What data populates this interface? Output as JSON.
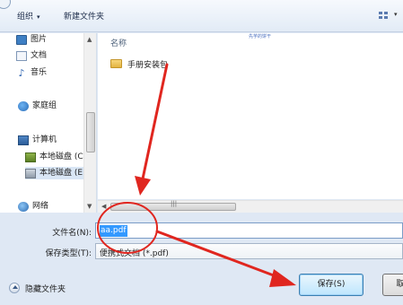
{
  "toolbar": {
    "organize_label": "组织",
    "organize_caret": "▾",
    "new_folder_label": "新建文件夹"
  },
  "nav": {
    "items": [
      {
        "label": "图片",
        "icon": "pictures-icon"
      },
      {
        "label": "文档",
        "icon": "documents-icon"
      },
      {
        "label": "音乐",
        "icon": "music-icon"
      },
      {
        "label": "家庭组",
        "icon": "homegroup-icon"
      },
      {
        "label": "计算机",
        "icon": "computer-icon"
      },
      {
        "label": "本地磁盘 (C",
        "icon": "local-disk-c-icon"
      },
      {
        "label": "本地磁盘 (E",
        "icon": "local-disk-e-icon"
      },
      {
        "label": "网络",
        "icon": "network-icon"
      }
    ]
  },
  "files": {
    "column_name": "名称",
    "watermark": "先芋的饼干",
    "items": [
      {
        "label": "手册安装包",
        "icon": "folder-icon"
      }
    ]
  },
  "form": {
    "filename_label": "文件名(N):",
    "filename_value": "aa.pdf",
    "filetype_label": "保存类型(T):",
    "filetype_value": "便携式文档 (*.pdf)"
  },
  "footer": {
    "hide_folders_label": "隐藏文件夹",
    "save_label": "保存(S)",
    "cancel_label": "取"
  },
  "colors": {
    "selection": "#3399ff",
    "annotation": "#e0261f",
    "window_bg": "#dfe8f4"
  }
}
